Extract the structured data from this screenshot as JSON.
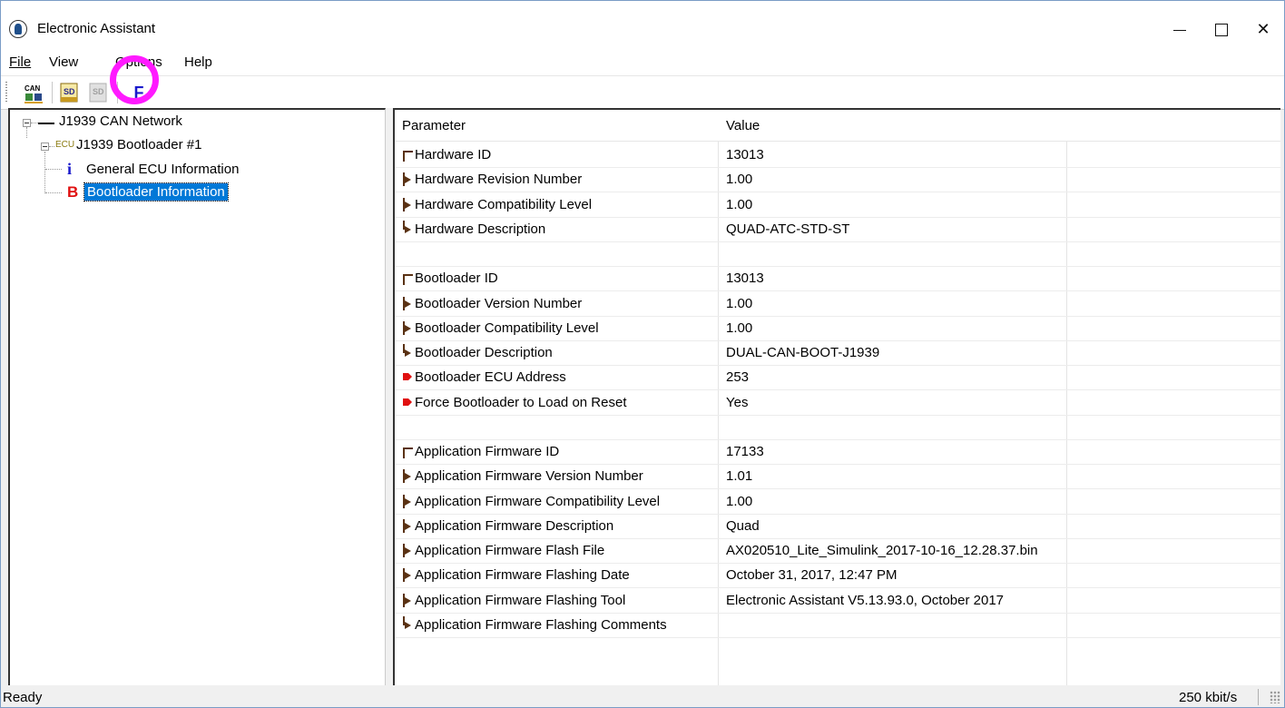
{
  "window": {
    "title": "Electronic Assistant",
    "controls": {
      "minimize": "minimize",
      "maximize": "maximize",
      "close": "close"
    }
  },
  "menu": {
    "file": "File",
    "view": "View",
    "options": "Options",
    "help": "Help"
  },
  "toolbar": {
    "buttons": [
      "can-network-icon",
      "sd-open-icon",
      "sd-disabled-icon",
      "flash-f-icon"
    ],
    "flash_label": "F",
    "can_label": "CAN",
    "sd_label": "SD",
    "highlight_color": "#ff1aff"
  },
  "tree": {
    "root": {
      "label": "J1939 CAN Network"
    },
    "ecu": {
      "prefix": "ECU",
      "label": "J1939 Bootloader #1"
    },
    "children": [
      {
        "icon": "i",
        "label": "General ECU Information"
      },
      {
        "icon": "B",
        "label": "Bootloader Information",
        "selected": true
      }
    ]
  },
  "grid": {
    "headers": {
      "parameter": "Parameter",
      "value": "Value"
    },
    "rows": [
      {
        "conn": "top",
        "param": "Hardware ID",
        "value": "13013"
      },
      {
        "conn": "mid",
        "param": "Hardware Revision Number",
        "value": "1.00"
      },
      {
        "conn": "mid",
        "param": "Hardware Compatibility Level",
        "value": "1.00"
      },
      {
        "conn": "end",
        "param": "Hardware Description",
        "value": "QUAD-ATC-STD-ST"
      },
      {
        "conn": "none",
        "param": "",
        "value": ""
      },
      {
        "conn": "top",
        "param": "Bootloader ID",
        "value": "13013"
      },
      {
        "conn": "mid",
        "param": "Bootloader Version Number",
        "value": "1.00"
      },
      {
        "conn": "mid",
        "param": "Bootloader Compatibility Level",
        "value": "1.00"
      },
      {
        "conn": "end",
        "param": "Bootloader Description",
        "value": "DUAL-CAN-BOOT-J1939"
      },
      {
        "conn": "red",
        "param": "Bootloader ECU Address",
        "value": "253"
      },
      {
        "conn": "red",
        "param": "Force Bootloader to Load on Reset",
        "value": "Yes"
      },
      {
        "conn": "none",
        "param": "",
        "value": ""
      },
      {
        "conn": "top",
        "param": "Application Firmware ID",
        "value": "17133"
      },
      {
        "conn": "mid",
        "param": "Application Firmware Version Number",
        "value": "1.01"
      },
      {
        "conn": "mid",
        "param": "Application Firmware Compatibility Level",
        "value": "1.00"
      },
      {
        "conn": "mid",
        "param": "Application Firmware Description",
        "value": "Quad"
      },
      {
        "conn": "mid",
        "param": "Application Firmware Flash File",
        "value": "AX020510_Lite_Simulink_2017-10-16_12.28.37.bin"
      },
      {
        "conn": "mid",
        "param": "Application Firmware Flashing Date",
        "value": "October 31, 2017, 12:47 PM"
      },
      {
        "conn": "mid",
        "param": "Application Firmware Flashing Tool",
        "value": "Electronic Assistant V5.13.93.0, October 2017"
      },
      {
        "conn": "end",
        "param": "Application Firmware Flashing Comments",
        "value": ""
      }
    ]
  },
  "status": {
    "left": "Ready",
    "right": "250 kbit/s"
  }
}
